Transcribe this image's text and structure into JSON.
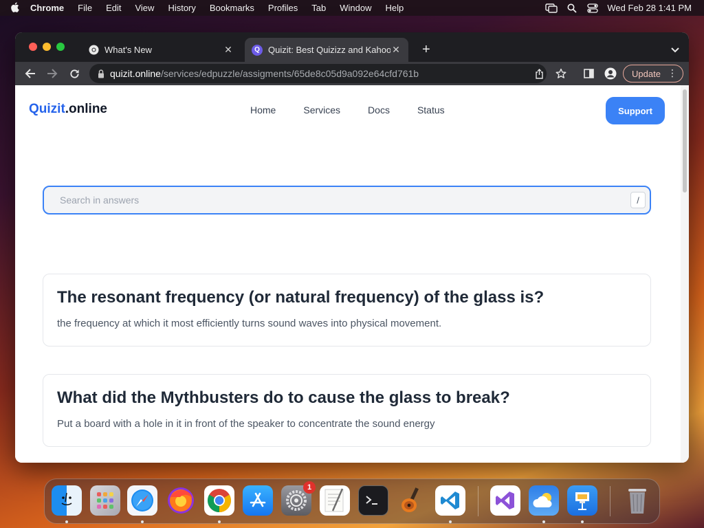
{
  "menubar": {
    "app_name": "Chrome",
    "items": [
      "File",
      "Edit",
      "View",
      "History",
      "Bookmarks",
      "Profiles",
      "Tab",
      "Window",
      "Help"
    ],
    "clock": "Wed Feb 28  1:41 PM"
  },
  "browser": {
    "tabs": [
      {
        "title": "What's New",
        "icon": "chrome-icon"
      },
      {
        "title": "Quizit: Best Quizizz and Kahoot",
        "icon": "quizit-favicon",
        "active": true
      }
    ],
    "url_host": "quizit.online",
    "url_path": "/services/edpuzzle/assigments/65de8c05d9a092e64cfd761b",
    "update_label": "Update"
  },
  "site": {
    "logo_brand": "Quizit",
    "logo_suffix": ".online",
    "nav": [
      "Home",
      "Services",
      "Docs",
      "Status"
    ],
    "support_label": "Support",
    "search_placeholder": "Search in answers",
    "search_shortcut": "/"
  },
  "qa": [
    {
      "question": "The resonant frequency (or natural frequency) of the glass is?",
      "answer": " the frequency at which it most efficiently turns sound waves into physical movement."
    },
    {
      "question": "What did the Mythbusters do to cause the glass to break?",
      "answer": "Put a board with a hole in it in front of the speaker to concentrate the sound energy"
    }
  ],
  "dock": {
    "apps": [
      "finder-icon",
      "launchpad-icon",
      "safari-icon",
      "firefox-icon",
      "chrome-icon",
      "app-store-icon",
      "system-settings-icon",
      "textedit-icon",
      "terminal-icon",
      "garageband-icon",
      "vscode-icon",
      "visual-studio-icon",
      "weather-icon",
      "keynote-icon",
      "trash-icon"
    ],
    "settings_badge": "1"
  }
}
